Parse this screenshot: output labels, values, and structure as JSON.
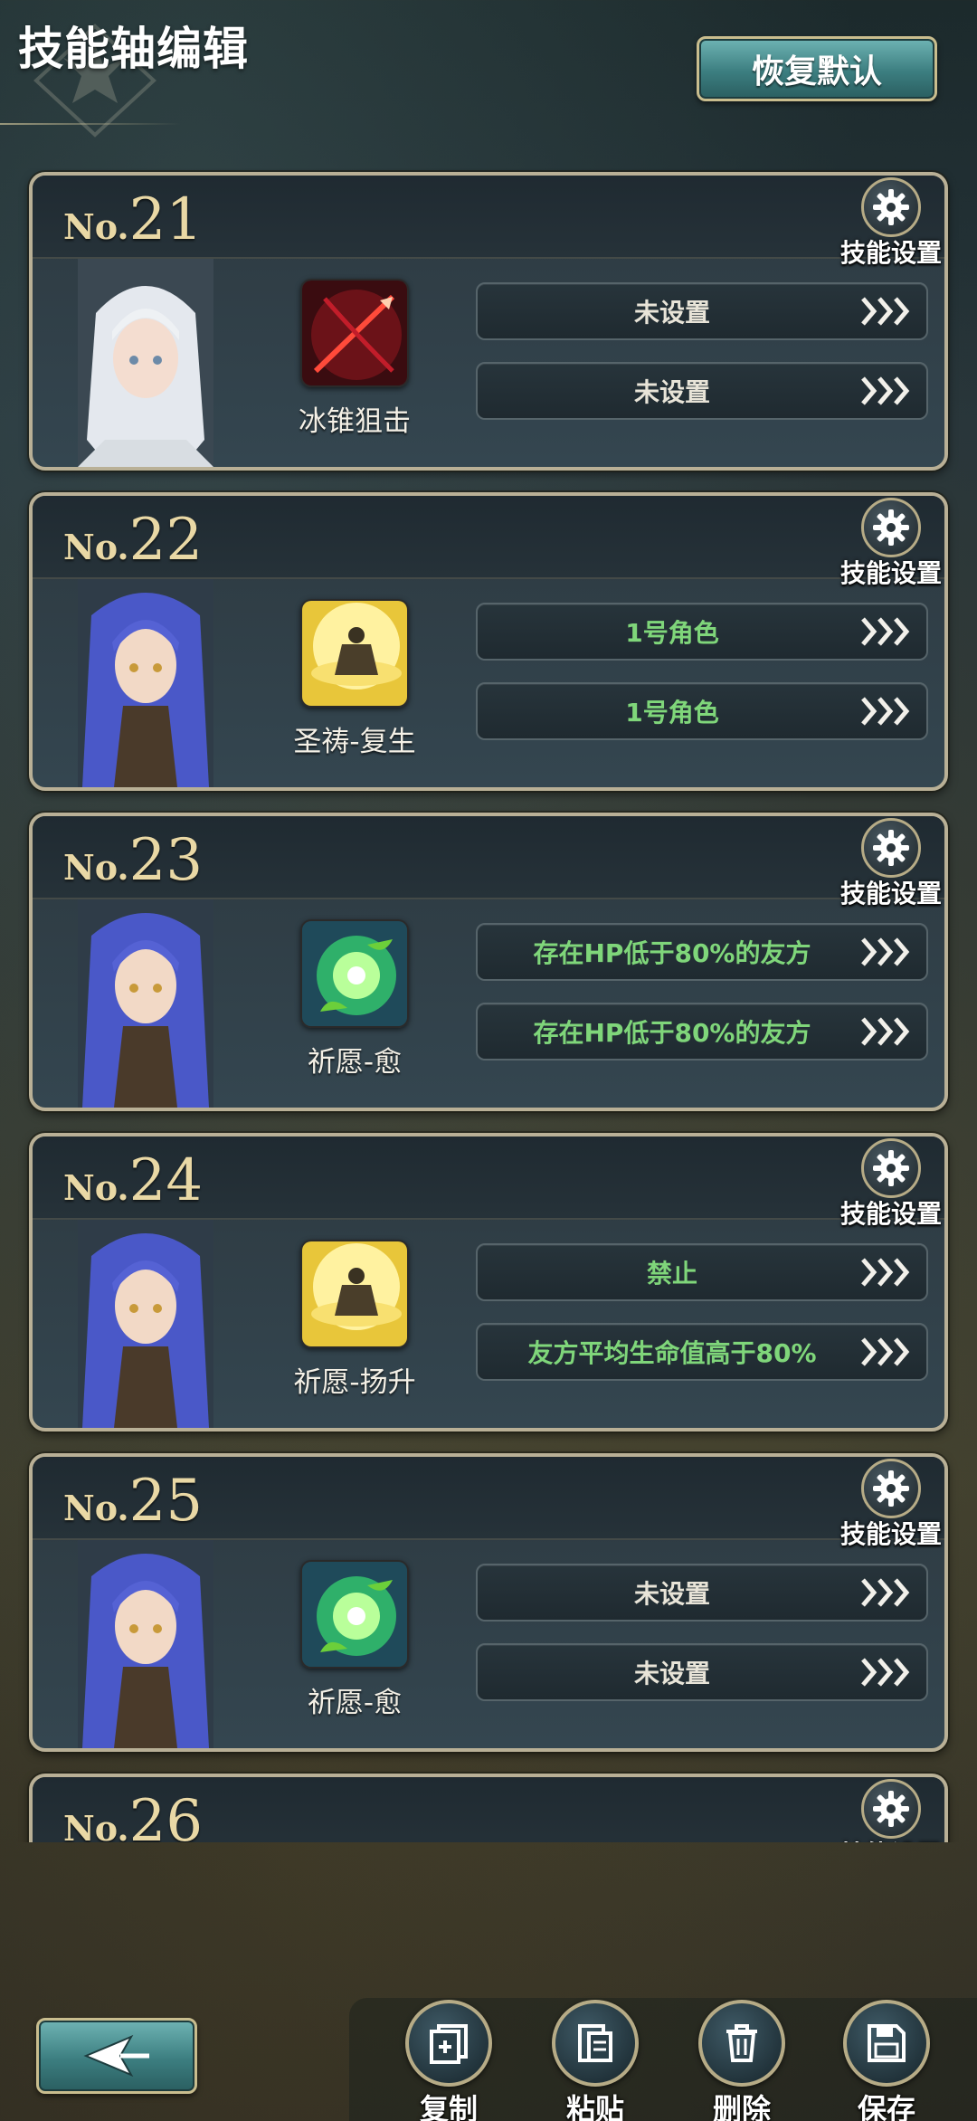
{
  "header": {
    "title": "技能轴编辑",
    "restore_label": "恢复默认"
  },
  "cards": [
    {
      "prefix": "No.",
      "number": "21",
      "settings_label": "技能设置",
      "portrait": "white-haired-girl",
      "skill_icon": "red-arrow-skill",
      "skill_name": "冰锥狙击",
      "conditions": [
        {
          "text": "未设置",
          "state": "unset"
        },
        {
          "text": "未设置",
          "state": "unset"
        }
      ]
    },
    {
      "prefix": "No.",
      "number": "22",
      "settings_label": "技能设置",
      "portrait": "blue-haired-girl",
      "skill_icon": "golden-resurrect-skill",
      "skill_name": "圣祷-复生",
      "conditions": [
        {
          "text": "1号角色",
          "state": "set"
        },
        {
          "text": "1号角色",
          "state": "set"
        }
      ]
    },
    {
      "prefix": "No.",
      "number": "23",
      "settings_label": "技能设置",
      "portrait": "blue-haired-girl",
      "skill_icon": "green-heal-skill",
      "skill_name": "祈愿-愈",
      "conditions": [
        {
          "text": "存在HP低于80%的友方",
          "state": "set"
        },
        {
          "text": "存在HP低于80%的友方",
          "state": "set"
        }
      ]
    },
    {
      "prefix": "No.",
      "number": "24",
      "settings_label": "技能设置",
      "portrait": "blue-haired-girl",
      "skill_icon": "golden-resurrect-skill",
      "skill_name": "祈愿-扬升",
      "conditions": [
        {
          "text": "禁止",
          "state": "set"
        },
        {
          "text": "友方平均生命值高于80%",
          "state": "set"
        }
      ]
    },
    {
      "prefix": "No.",
      "number": "25",
      "settings_label": "技能设置",
      "portrait": "blue-haired-girl",
      "skill_icon": "green-heal-skill",
      "skill_name": "祈愿-愈",
      "conditions": [
        {
          "text": "未设置",
          "state": "unset"
        },
        {
          "text": "未设置",
          "state": "unset"
        }
      ]
    },
    {
      "prefix": "No.",
      "number": "26",
      "settings_label": "技能设置"
    }
  ],
  "toolbar": {
    "copy_label": "复制",
    "paste_label": "粘贴",
    "delete_label": "删除",
    "save_label": "保存"
  },
  "colors": {
    "condition_set": "#7fd67a",
    "condition_unset": "#e8e4d8",
    "accent_teal": "#3c7e80",
    "frame_gold": "#b9b096"
  }
}
